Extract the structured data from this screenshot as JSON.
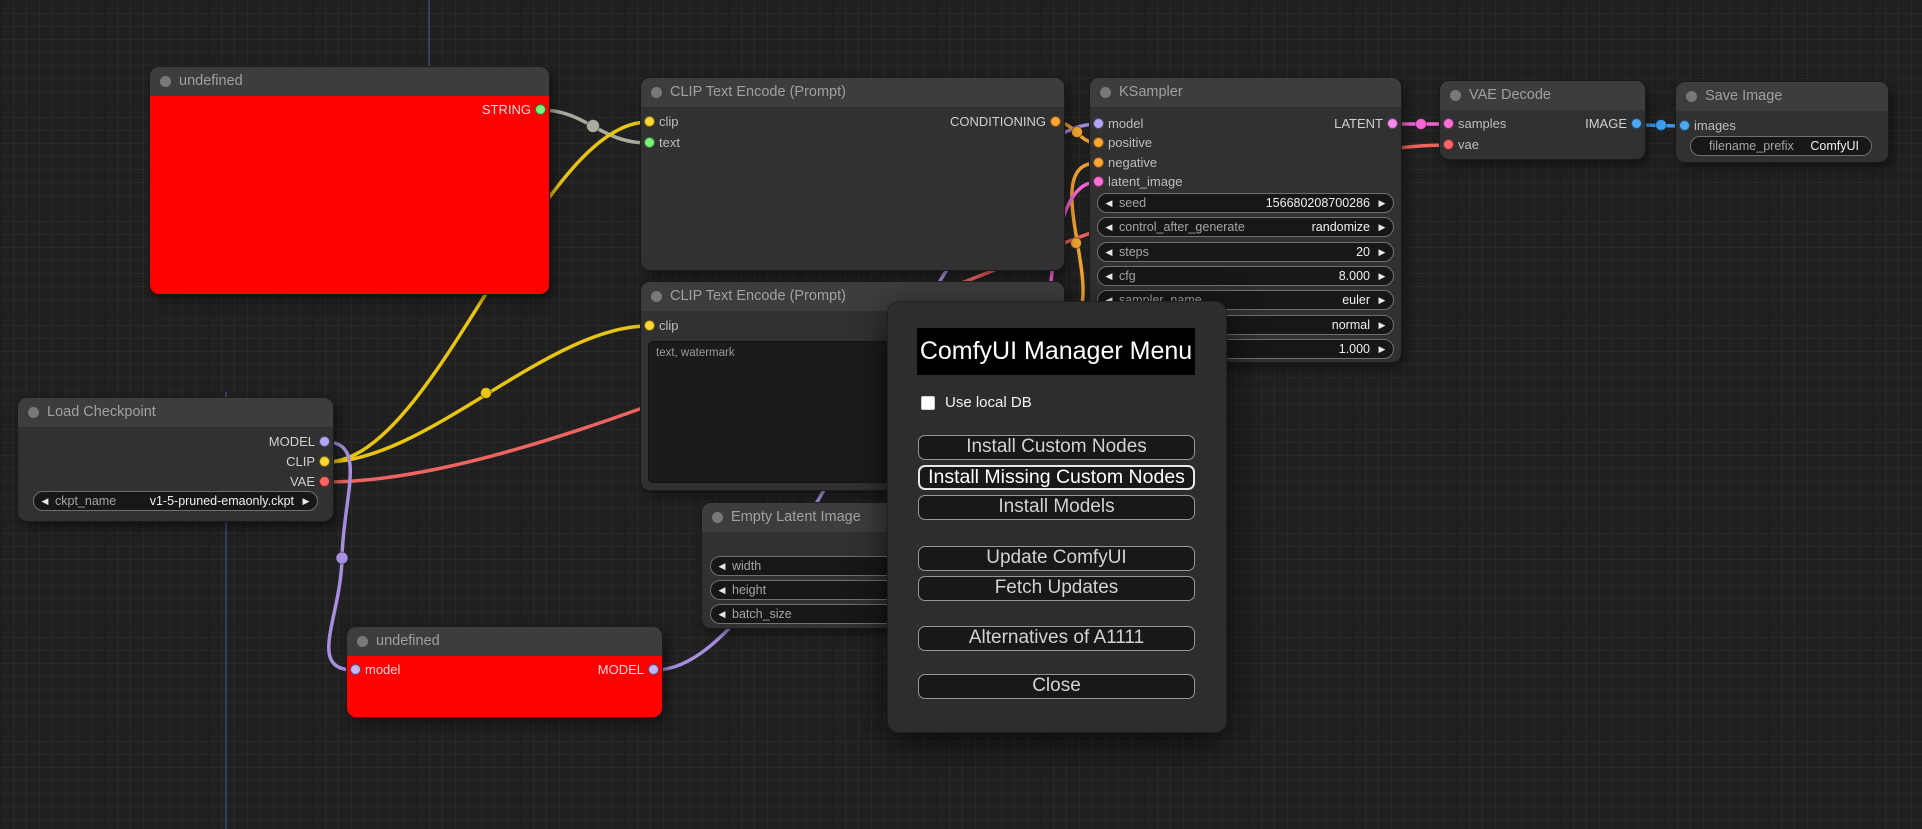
{
  "icons": {
    "arrow_left": "◀",
    "arrow_right": "▶",
    "collapse_dot": "circle",
    "checkbox": "unchecked-square"
  },
  "colors": {
    "node_red": "#fe0202",
    "slot_gray": "#787878",
    "slot_green": "#7df17c",
    "slot_yellow": "#fdd835",
    "slot_orange": "#ffa531",
    "slot_purple": "#b2a6f5",
    "slot_lavender": "#c3b5f7",
    "slot_pink": "#ff70d8",
    "slot_magenta": "#f28be9",
    "slot_red": "#ff6567",
    "slot_blue": "#4da6f2",
    "wire_gray": "#a9ad9d",
    "wire_yellow": "#e8c413",
    "wire_red": "#ef6460",
    "wire_purple": "#a78fe0",
    "wire_orange": "#f0a431",
    "wire_pink": "#f565d3",
    "wire_blue": "#3d9df0",
    "axis_blue": "#45598a"
  },
  "nodes": {
    "undefined_top": {
      "title": "undefined",
      "outputs": [
        {
          "label": "STRING"
        }
      ]
    },
    "clip_encode_pos": {
      "title": "CLIP Text Encode (Prompt)",
      "inputs": [
        {
          "label": "clip"
        },
        {
          "label": "text"
        }
      ],
      "outputs": [
        {
          "label": "CONDITIONING"
        }
      ]
    },
    "clip_encode_neg": {
      "title": "CLIP Text Encode (Prompt)",
      "inputs": [
        {
          "label": "clip"
        }
      ],
      "text_value": "text, watermark"
    },
    "ksampler": {
      "title": "KSampler",
      "inputs": [
        {
          "label": "model"
        },
        {
          "label": "positive"
        },
        {
          "label": "negative"
        },
        {
          "label": "latent_image"
        }
      ],
      "outputs": [
        {
          "label": "LATENT"
        }
      ],
      "widgets": [
        {
          "label": "seed",
          "value": "156680208700286"
        },
        {
          "label": "control_after_generate",
          "value": "randomize"
        },
        {
          "label": "steps",
          "value": "20"
        },
        {
          "label": "cfg",
          "value": "8.000"
        },
        {
          "label": "sampler_name",
          "value": "euler"
        },
        {
          "label": "",
          "value": "normal"
        },
        {
          "label": "",
          "value": "1.000"
        }
      ]
    },
    "vae_decode": {
      "title": "VAE Decode",
      "inputs": [
        {
          "label": "samples"
        },
        {
          "label": "vae"
        }
      ],
      "outputs": [
        {
          "label": "IMAGE"
        }
      ]
    },
    "save_image": {
      "title": "Save Image",
      "inputs": [
        {
          "label": "images"
        }
      ],
      "widgets": [
        {
          "label": "filename_prefix",
          "value": "ComfyUI"
        }
      ]
    },
    "load_checkpoint": {
      "title": "Load Checkpoint",
      "outputs": [
        {
          "label": "MODEL"
        },
        {
          "label": "CLIP"
        },
        {
          "label": "VAE"
        }
      ],
      "widgets": [
        {
          "label": "ckpt_name",
          "value": "v1-5-pruned-emaonly.ckpt"
        }
      ]
    },
    "empty_latent": {
      "title": "Empty Latent Image",
      "widgets": [
        {
          "label": "width",
          "value": ""
        },
        {
          "label": "height",
          "value": ""
        },
        {
          "label": "batch_size",
          "value": ""
        }
      ]
    },
    "undefined_bottom": {
      "title": "undefined",
      "inputs": [
        {
          "label": "model"
        }
      ],
      "outputs": [
        {
          "label": "MODEL"
        }
      ]
    }
  },
  "wires": [
    {
      "from": "undefined_top.STRING",
      "to": "clip_encode_pos.text",
      "color_key": "wire_gray"
    },
    {
      "from": "load_checkpoint.CLIP",
      "to": "clip_encode_pos.clip",
      "color_key": "wire_yellow"
    },
    {
      "from": "load_checkpoint.CLIP",
      "to": "clip_encode_neg.clip",
      "color_key": "wire_yellow"
    },
    {
      "from": "load_checkpoint.VAE",
      "to": "vae_decode.vae",
      "color_key": "wire_red"
    },
    {
      "from": "load_checkpoint.MODEL",
      "to": "undefined_bottom.model",
      "color_key": "wire_purple"
    },
    {
      "from": "undefined_bottom.MODEL",
      "to": "ksampler.model",
      "color_key": "wire_purple"
    },
    {
      "from": "clip_encode_pos.CONDITIONING",
      "to": "ksampler.positive",
      "color_key": "wire_orange"
    },
    {
      "from": "clip_encode_neg.CONDITIONING",
      "to": "ksampler.negative",
      "color_key": "wire_orange"
    },
    {
      "from": "empty_latent.LATENT",
      "to": "ksampler.latent_image",
      "color_key": "wire_pink"
    },
    {
      "from": "ksampler.LATENT",
      "to": "vae_decode.samples",
      "color_key": "wire_pink"
    },
    {
      "from": "vae_decode.IMAGE",
      "to": "save_image.images",
      "color_key": "wire_blue"
    }
  ],
  "dialog": {
    "title": "ComfyUI Manager Menu",
    "checkbox_label": "Use local DB",
    "checkbox_checked": false,
    "buttons": [
      {
        "label": "Install Custom Nodes"
      },
      {
        "label": "Install Missing Custom Nodes"
      },
      {
        "label": "Install Models"
      },
      {
        "label": "Update ComfyUI"
      },
      {
        "label": "Fetch Updates"
      },
      {
        "label": "Alternatives of A1111"
      },
      {
        "label": "Close"
      }
    ]
  }
}
